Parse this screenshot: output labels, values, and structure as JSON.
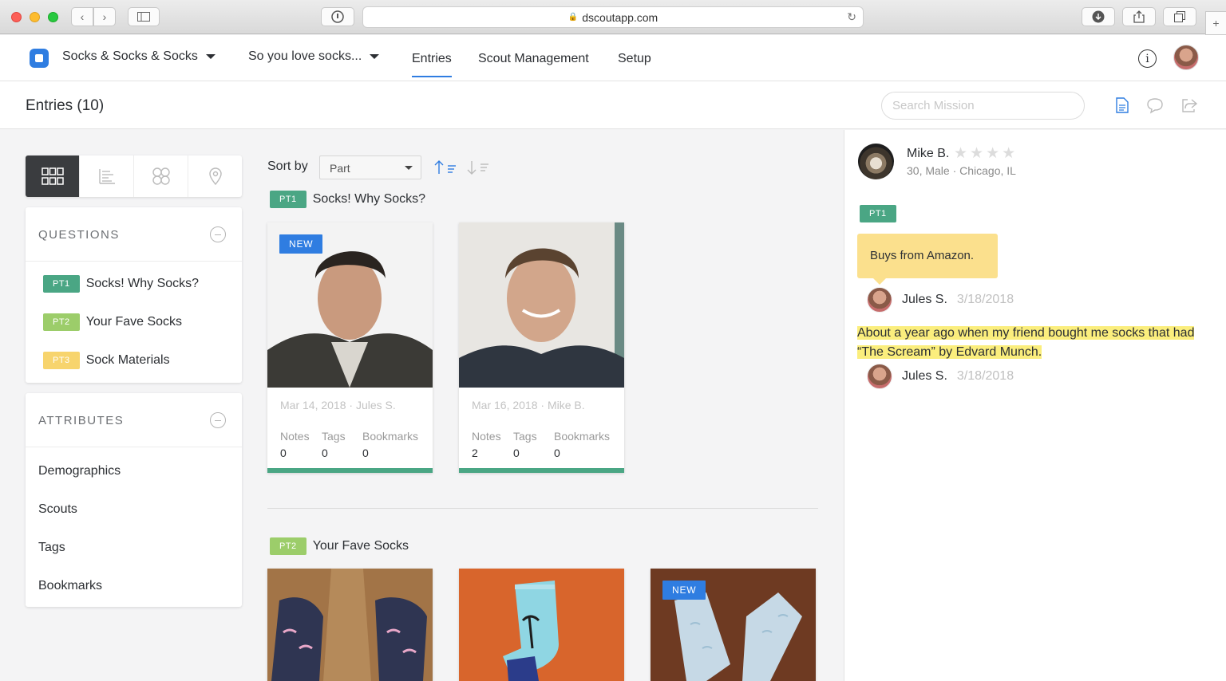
{
  "browser": {
    "url": "dscoutapp.com"
  },
  "header": {
    "project": "Socks & Socks & Socks",
    "mission": "So you love socks...",
    "tabs": [
      {
        "label": "Entries",
        "active": true
      },
      {
        "label": "Scout Management",
        "active": false
      },
      {
        "label": "Setup",
        "active": false
      }
    ]
  },
  "subheader": {
    "title": "Entries (10)",
    "search_placeholder": "Search Mission"
  },
  "sidebar": {
    "questions_title": "QUESTIONS",
    "questions": [
      {
        "tag": "PT1",
        "label": "Socks! Why Socks?",
        "color": "#4aa684"
      },
      {
        "tag": "PT2",
        "label": "Your Fave Socks",
        "color": "#9ccd6a"
      },
      {
        "tag": "PT3",
        "label": "Sock Materials",
        "color": "#f7d46d"
      }
    ],
    "attributes_title": "ATTRIBUTES",
    "attributes": [
      "Demographics",
      "Scouts",
      "Tags",
      "Bookmarks"
    ]
  },
  "main": {
    "sort_label": "Sort by",
    "sort_value": "Part",
    "sections": [
      {
        "tag": "PT1",
        "title": "Socks! Why Socks?",
        "cards": [
          {
            "badge": "NEW",
            "meta": "Mar 14, 2018 · Jules S.",
            "notes_label": "Notes",
            "notes": "0",
            "tags_label": "Tags",
            "tags": "0",
            "bookmarks_label": "Bookmarks",
            "bookmarks": "0"
          },
          {
            "badge": "",
            "meta": "Mar 16, 2018 · Mike B.",
            "notes_label": "Notes",
            "notes": "2",
            "tags_label": "Tags",
            "tags": "0",
            "bookmarks_label": "Bookmarks",
            "bookmarks": "0"
          }
        ]
      },
      {
        "tag": "PT2",
        "title": "Your Fave Socks",
        "cards": [
          {
            "badge": ""
          },
          {
            "badge": ""
          },
          {
            "badge": "NEW"
          }
        ]
      }
    ]
  },
  "detail": {
    "scout_name": "Mike B.",
    "scout_info": "30, Male · Chicago, IL",
    "rating": "★★★★",
    "tag": "PT1",
    "note": "Buys from Amazon.",
    "note_author": "Jules S.",
    "note_date": "3/18/2018",
    "highlight": "About a year ago when my friend bought me socks that had “The Scream” by Edvard Munch.",
    "highlight_author": "Jules S.",
    "highlight_date": "3/18/2018"
  },
  "colors": {
    "accent": "#2f7de1",
    "pt1": "#4aa684",
    "pt2": "#9ccd6a",
    "pt3": "#f7d46d",
    "highlight": "#fbee7d",
    "note": "#fbe08d"
  }
}
